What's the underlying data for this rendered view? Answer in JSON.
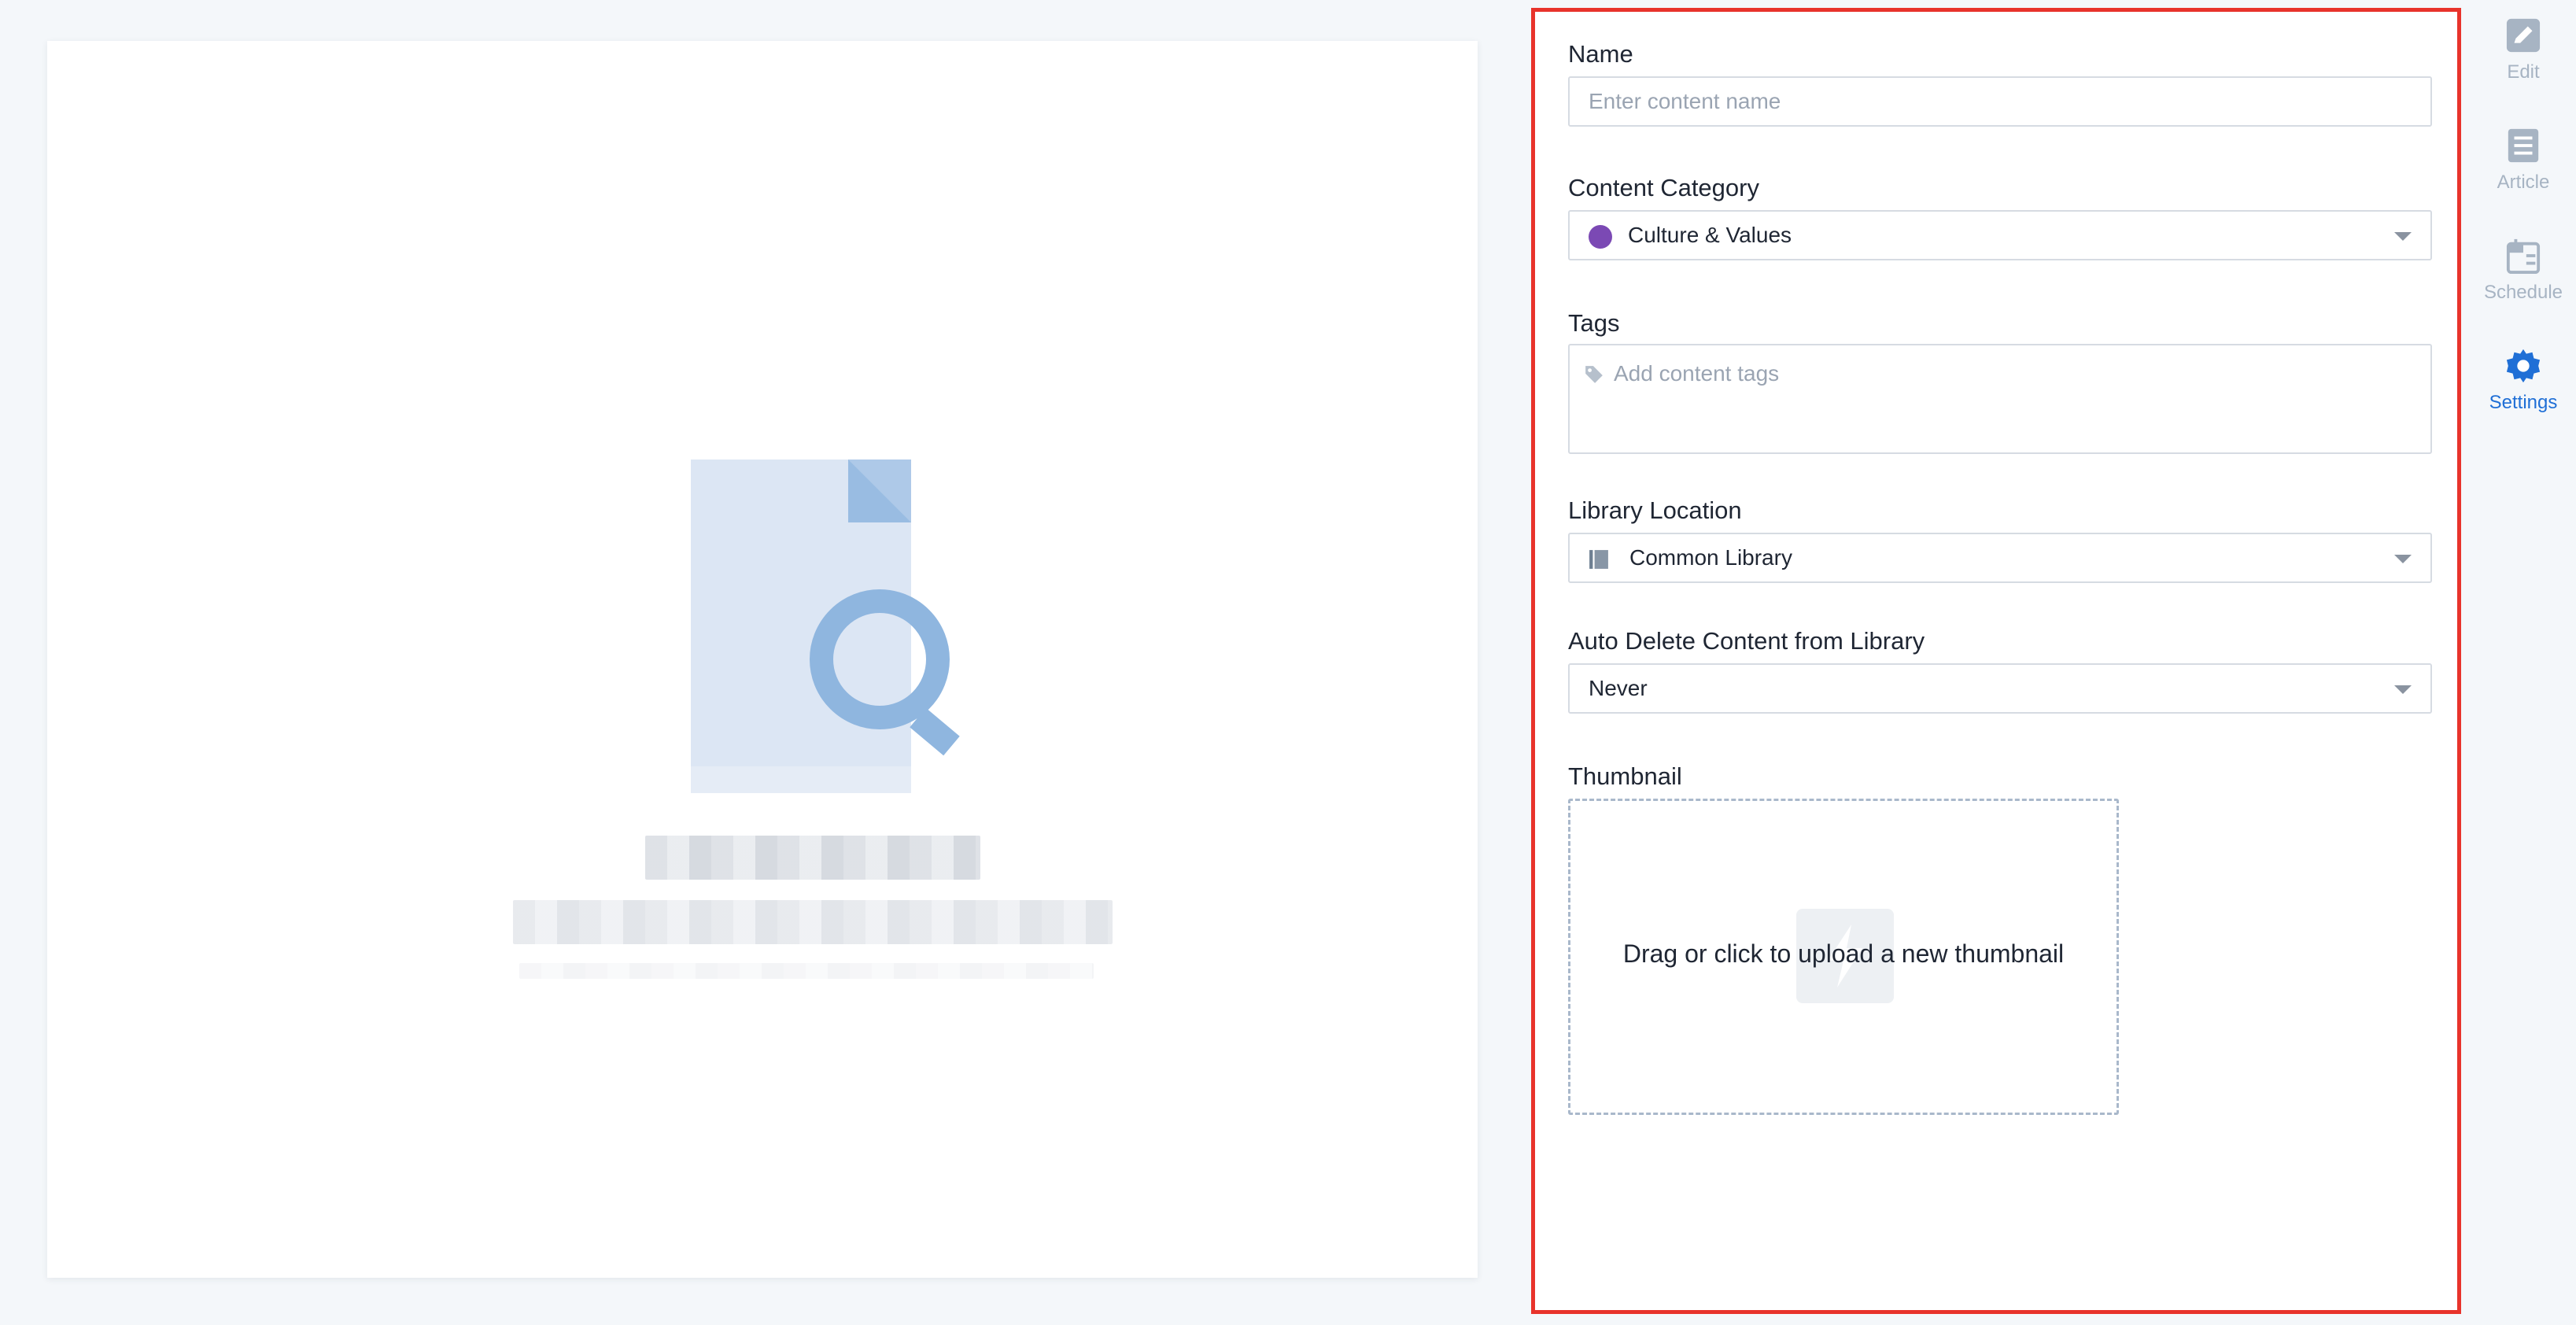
{
  "colors": {
    "accent": "#1f6fd6",
    "panel_border": "#e8332b",
    "category_dot": "#7b49b4",
    "muted_icon": "#a7b4c3"
  },
  "settings": {
    "name": {
      "label": "Name",
      "value": "",
      "placeholder": "Enter content name"
    },
    "content_category": {
      "label": "Content Category",
      "selected": "Culture & Values"
    },
    "tags": {
      "label": "Tags",
      "placeholder": "Add content tags"
    },
    "library_location": {
      "label": "Library Location",
      "selected": "Common Library"
    },
    "auto_delete": {
      "label": "Auto Delete Content from Library",
      "selected": "Never"
    },
    "thumbnail": {
      "label": "Thumbnail",
      "upload_text": "Drag or click to upload a new thumbnail"
    }
  },
  "toolbar": {
    "items": [
      {
        "label": "Edit",
        "icon": "pencil-icon",
        "active": false
      },
      {
        "label": "Article",
        "icon": "article-icon",
        "active": false
      },
      {
        "label": "Schedule",
        "icon": "calendar-icon",
        "active": false
      },
      {
        "label": "Settings",
        "icon": "gear-icon",
        "active": true
      }
    ]
  }
}
